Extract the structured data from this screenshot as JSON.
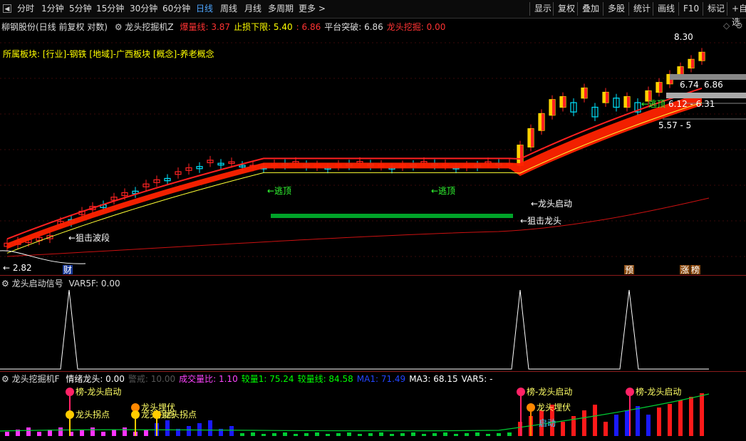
{
  "toolbar": {
    "periods": [
      "分时",
      "1分钟",
      "5分钟",
      "15分钟",
      "30分钟",
      "60分钟",
      "日线",
      "周线",
      "月线",
      "多周期",
      "更多 >"
    ],
    "active_index": 6,
    "right_buttons": [
      "显示",
      "复权",
      "叠加",
      "多股",
      "统计",
      "画线",
      "F10",
      "标记",
      "+自选"
    ]
  },
  "main_panel": {
    "stock": "柳钢股份(日线 前复权 对数)",
    "indicator_name": "龙头挖掘机Z",
    "items": [
      {
        "label": "爆量线: 3.87",
        "color": "#ff3333"
      },
      {
        "label": "止损下限: 5.40",
        "color": "#ffff00"
      },
      {
        "label": ": 6.86",
        "color": "#ff3333"
      },
      {
        "label": "平台突破: 6.86",
        "color": "#dddddd"
      },
      {
        "label": "龙头挖掘: 0.00",
        "color": "#ff3333"
      }
    ],
    "sector_text": "所属板块: [行业]-钢铁 [地域]-广西板块 [概念]-养老概念",
    "annotations": {
      "escape_top_1": "←逃顶",
      "escape_top_2": "←逃顶",
      "escape_top_3": "←逃顶",
      "dragon_start": "←龙头启动",
      "snipe_flat": "←狙击龙头",
      "snipe_left": "←狙击波段",
      "snipe_label2": "←狙击龙头"
    },
    "price_labels": {
      "high": "8.30",
      "level_a": "6.74",
      "level_b": "6.86",
      "level_c": "6.12 - 6.31",
      "level_d": "5.57 - 5",
      "low": "← 2.82"
    },
    "badges": {
      "cai": "财",
      "yu": "预",
      "zhang": "涨",
      "bang": "榜"
    }
  },
  "signal_panel": {
    "title": "龙头启动信号",
    "var": "VAR5F: 0.00"
  },
  "bottom_panel": {
    "title": "龙头挖掘机F",
    "items": [
      {
        "label": "情绪龙头: 0.00",
        "color": "#ffffff"
      },
      {
        "label": "警戒: 10.00",
        "color": "#555555"
      },
      {
        "label": "成交量比: 1.10",
        "color": "#ff44ff"
      },
      {
        "label": "较量1: 75.24",
        "color": "#00ff00"
      },
      {
        "label": "较量线: 84.58",
        "color": "#00ff00"
      },
      {
        "label": "MA1: 71.49",
        "color": "#2244ff"
      },
      {
        "label": "MA3: 68.15",
        "color": "#ffffff"
      },
      {
        "label": "VAR5: -",
        "color": "#ffffff"
      }
    ],
    "markers": {
      "bang_start_1": "榜-龙头启动",
      "bang_start_2": "榜-龙头启动",
      "bang_start_3": "榜-龙头启动",
      "ambush_1": "龙头埋伏",
      "ambush_2": "龙头埋伏",
      "inflection_1": "龙头拐点",
      "inflection_2": "龙头拐点",
      "inflection_3": "龙头拐点",
      "start_small": "启动"
    }
  },
  "colors": {
    "up": "#ff2222",
    "down": "#00e5ff",
    "ma_red": "#ff2020",
    "ma_yellow": "#ffff33",
    "band": "#ff2200",
    "vol_blue": "#1a1aff",
    "vol_red": "#ff1a1a",
    "magenta": "#ff33ff"
  }
}
